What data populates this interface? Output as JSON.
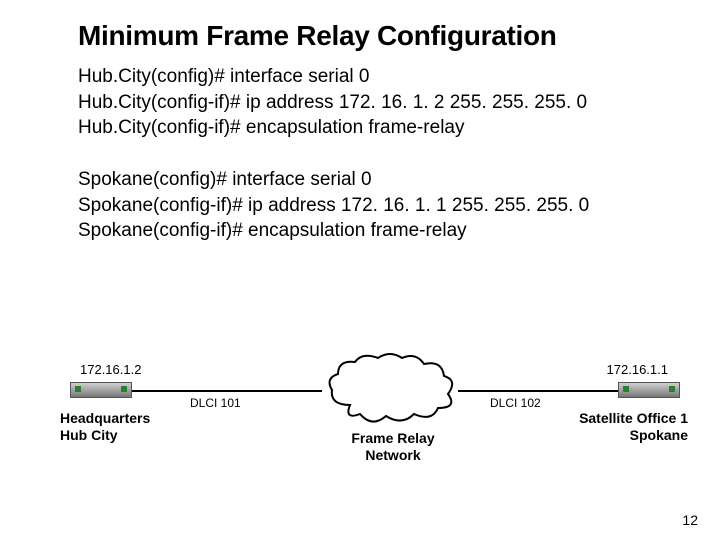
{
  "title": "Minimum Frame Relay Configuration",
  "config_block_1": {
    "line1": "Hub.City(config)# interface serial 0",
    "line2": "Hub.City(config-if)# ip address 172. 16. 1. 2 255. 255. 255. 0",
    "line3": "Hub.City(config-if)# encapsulation frame-relay"
  },
  "config_block_2": {
    "line1": "Spokane(config)# interface serial 0",
    "line2": "Spokane(config-if)# ip address 172. 16. 1. 1 255. 255. 255. 0",
    "line3": "Spokane(config-if)# encapsulation frame-relay"
  },
  "diagram": {
    "left_ip": "172.16.1.2",
    "right_ip": "172.16.1.1",
    "left_dlci": "DLCI 101",
    "right_dlci": "DLCI 102",
    "left_site_line1": "Headquarters",
    "left_site_line2": "Hub City",
    "right_site_line1": "Satellite Office 1",
    "right_site_line2": "Spokane",
    "cloud_line1": "Frame Relay",
    "cloud_line2": "Network"
  },
  "page_number": "12"
}
